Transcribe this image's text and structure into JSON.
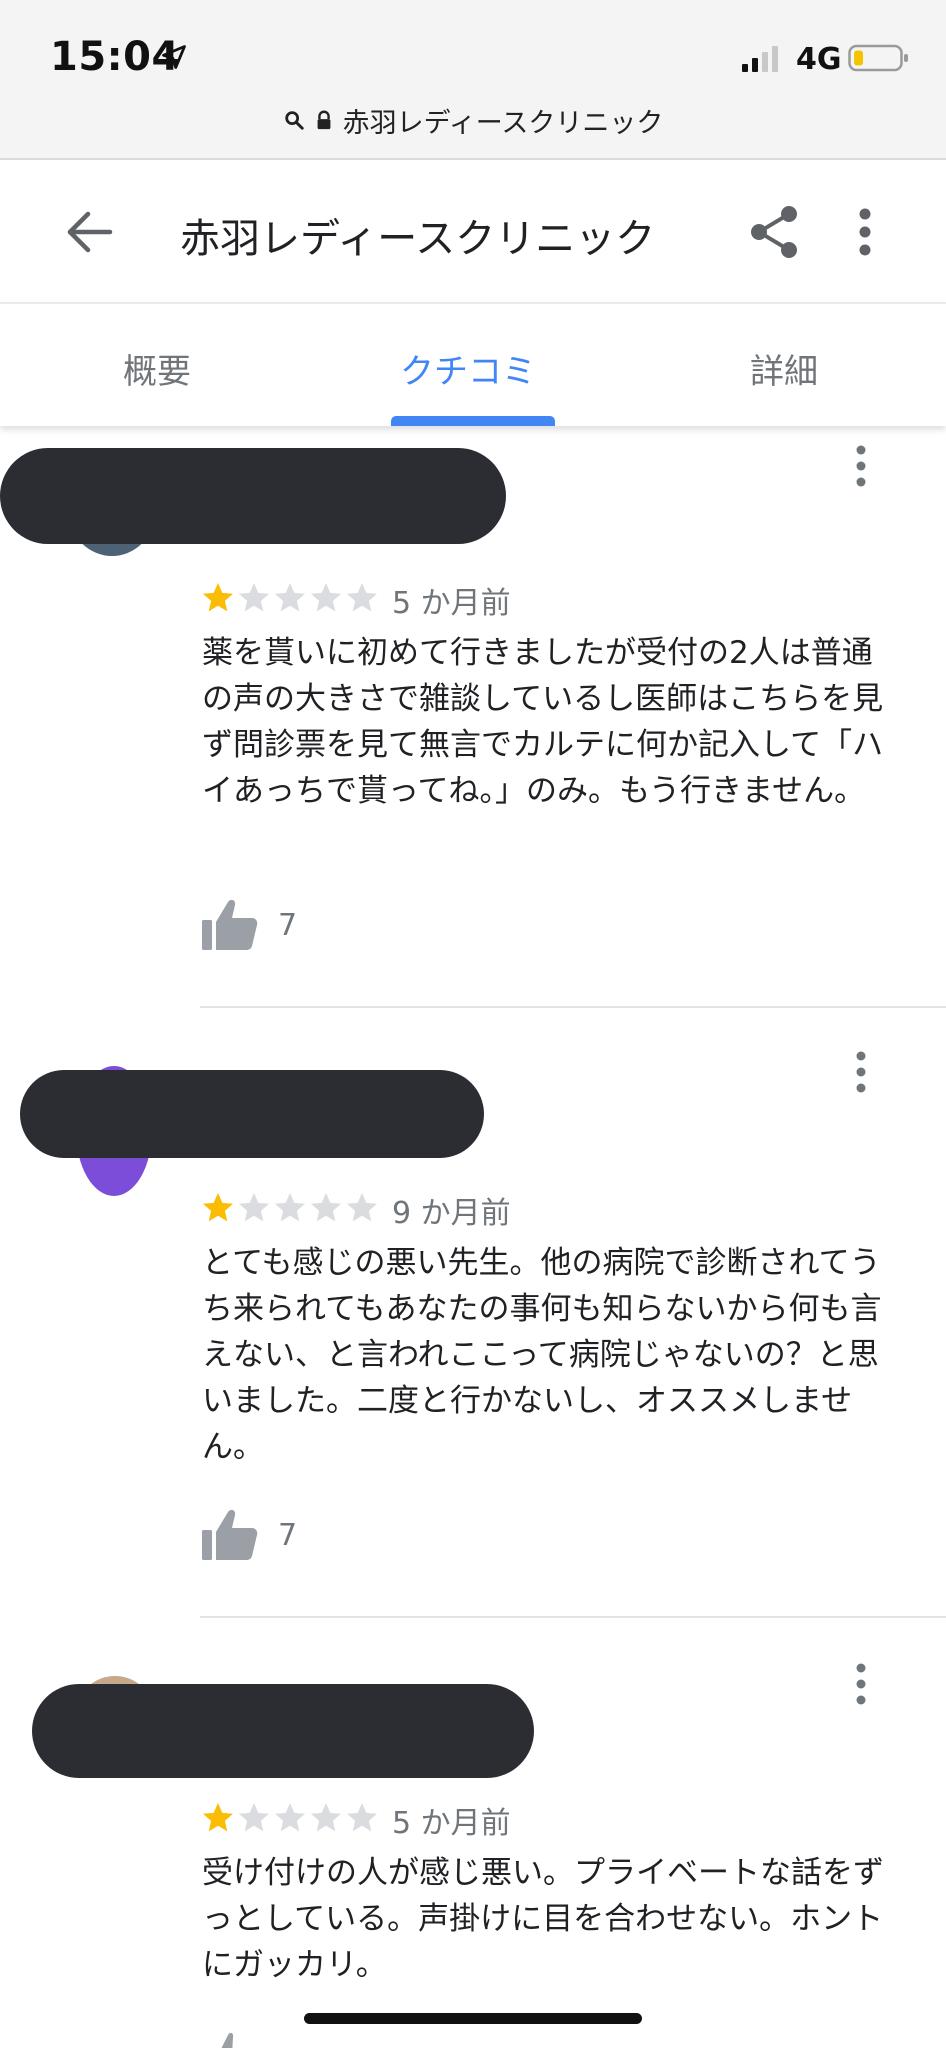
{
  "status_bar": {
    "time": "15:04",
    "network": "4G"
  },
  "url_bar": {
    "url_text": "赤羽レディースクリニック"
  },
  "app_bar": {
    "title": "赤羽レディースクリニック"
  },
  "tabs": [
    {
      "label": "概要",
      "active": false
    },
    {
      "label": "クチコミ",
      "active": true
    },
    {
      "label": "詳細",
      "active": false
    }
  ],
  "colors": {
    "accent": "#4285f4",
    "star_filled": "#fbbc04",
    "star_empty": "#dadce0",
    "redaction": "#2b2d33"
  },
  "reviews": [
    {
      "rating": 1,
      "max_rating": 5,
      "date": "5 か月前",
      "text": "薬を貰いに初めて行きましたが受付の2人は普通の声の大きさで雑談しているし医師はこちらを見ず問診票を見て無言でカルテに何か記入して「ハイあっちで貰ってね。」のみ。もう行きません。",
      "likes": "7"
    },
    {
      "rating": 1,
      "max_rating": 5,
      "date": "9 か月前",
      "text": "とても感じの悪い先生。他の病院で診断されてうち来られてもあなたの事何も知らないから何も言えない、と言われここって病院じゃないの？と思いました。二度と行かないし、オススメしません。",
      "likes": "7"
    },
    {
      "rating": 1,
      "max_rating": 5,
      "date": "5 か月前",
      "text": "受け付けの人が感じ悪い。プライベートな話をずっとしている。声掛けに目を合わせない。ホントにガッカリ。",
      "likes": ""
    }
  ]
}
